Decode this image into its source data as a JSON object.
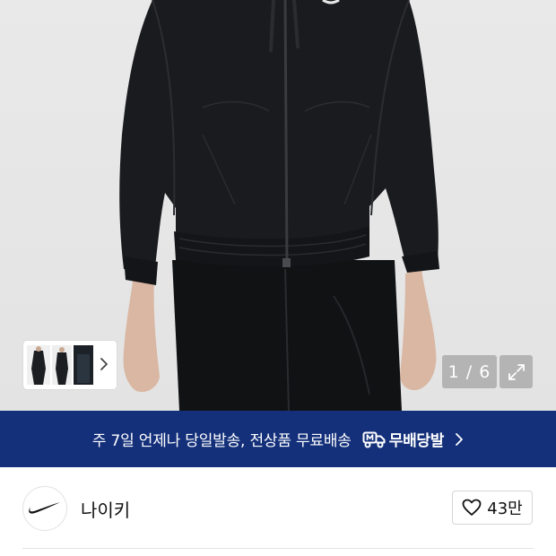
{
  "gallery": {
    "image_alt": "",
    "current_page": "1",
    "total_pages": "6",
    "counter_text": "1 / 6",
    "thumbnails": [
      "thumb-1",
      "thumb-2",
      "thumb-3"
    ]
  },
  "banner": {
    "text": "주 7일 언제나 당일발송, 전상품 무료배송",
    "badge_label": "무배당발",
    "badge_icon": "truck-icon",
    "background": "#14307a"
  },
  "brand": {
    "name": "나이키",
    "logo_icon": "swoosh-icon",
    "likes_label": "43만"
  }
}
